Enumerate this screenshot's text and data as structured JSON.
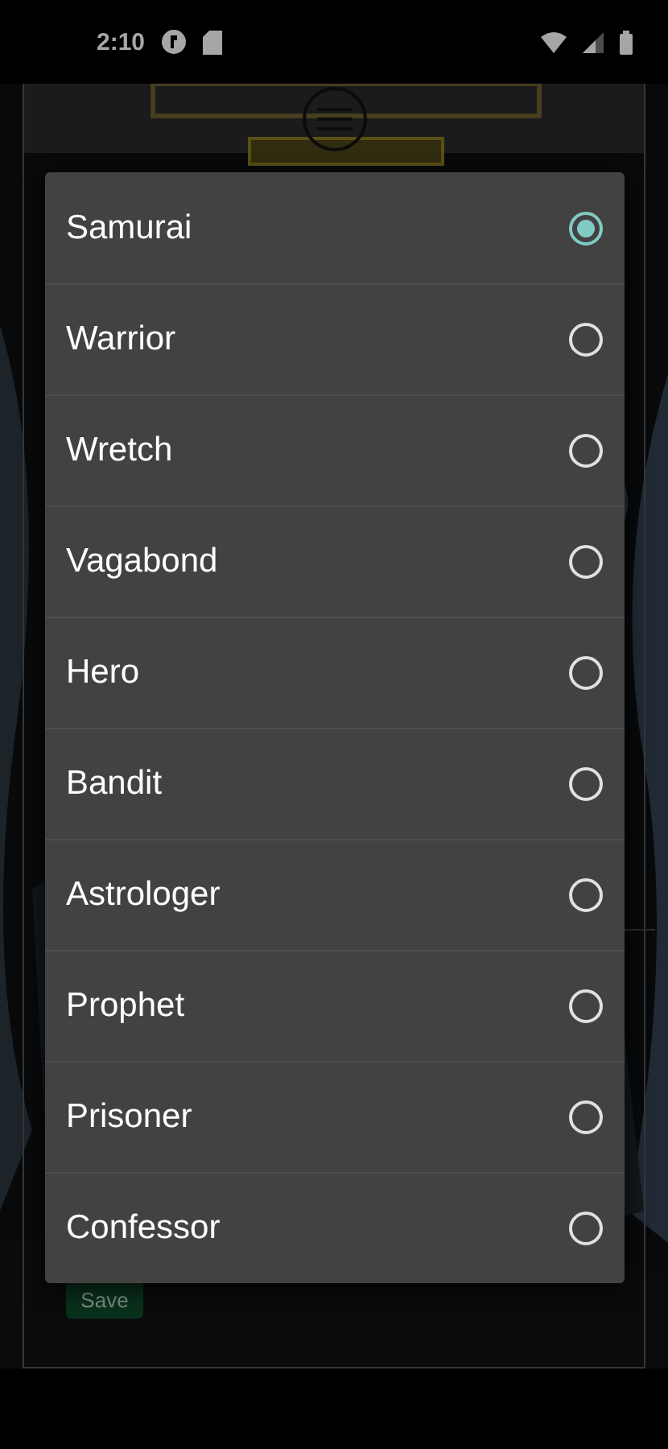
{
  "status_bar": {
    "time": "2:10"
  },
  "page": {
    "save_button": "Save"
  },
  "dialog": {
    "options": [
      {
        "label": "Samurai",
        "selected": true
      },
      {
        "label": "Warrior",
        "selected": false
      },
      {
        "label": "Wretch",
        "selected": false
      },
      {
        "label": "Vagabond",
        "selected": false
      },
      {
        "label": "Hero",
        "selected": false
      },
      {
        "label": "Bandit",
        "selected": false
      },
      {
        "label": "Astrologer",
        "selected": false
      },
      {
        "label": "Prophet",
        "selected": false
      },
      {
        "label": "Prisoner",
        "selected": false
      },
      {
        "label": "Confessor",
        "selected": false
      }
    ]
  }
}
